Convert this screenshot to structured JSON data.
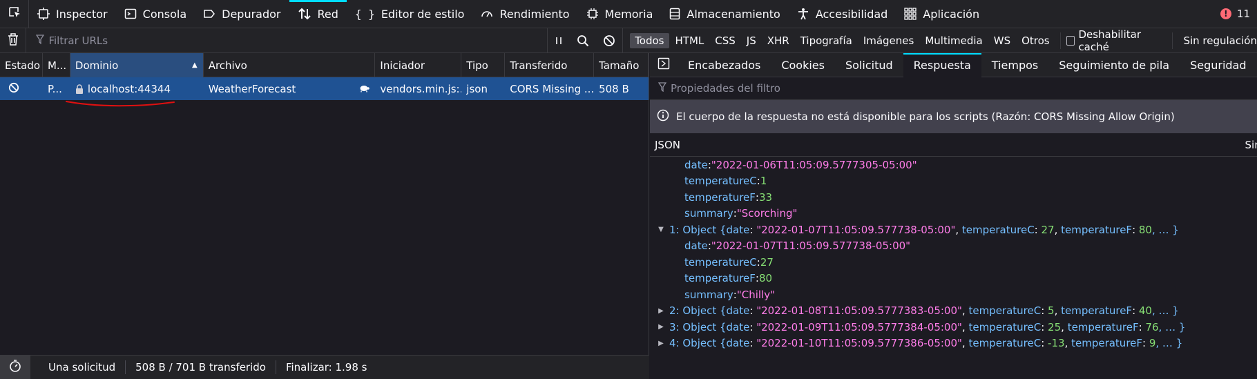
{
  "toolbox": {
    "tabs": [
      {
        "label": "Inspector",
        "icon": "inspector-icon"
      },
      {
        "label": "Consola",
        "icon": "console-icon"
      },
      {
        "label": "Depurador",
        "icon": "debugger-icon"
      },
      {
        "label": "Red",
        "icon": "network-arrows-icon",
        "selected": true
      },
      {
        "label": "Editor de estilo",
        "icon": "braces-icon"
      },
      {
        "label": "Rendimiento",
        "icon": "gauge-icon"
      },
      {
        "label": "Memoria",
        "icon": "chip-icon"
      },
      {
        "label": "Almacenamiento",
        "icon": "storage-icon"
      },
      {
        "label": "Accesibilidad",
        "icon": "accessibility-icon"
      },
      {
        "label": "Aplicación",
        "icon": "grid-icon"
      }
    ],
    "error_count": "11",
    "accent_color": "#00ddff",
    "error_color": "#ff6a75"
  },
  "toolbar": {
    "filter_placeholder": "Filtrar URLs",
    "types": [
      "Todos",
      "HTML",
      "CSS",
      "JS",
      "XHR",
      "Tipografía",
      "Imágenes",
      "Multimedia",
      "WS",
      "Otros"
    ],
    "active_type": "Todos",
    "disable_cache_label": "Deshabilitar caché",
    "throttle_label": "Sin regulación"
  },
  "table": {
    "columns": [
      "Estado",
      "M...",
      "Dominio",
      "Archivo",
      "Iniciador",
      "Tipo",
      "Transferido",
      "Tamaño"
    ],
    "sorted_column": "Dominio",
    "rows": [
      {
        "status_icon": "blocked-icon",
        "method": "P...",
        "domain": "localhost:44344",
        "file": "WeatherForecast",
        "initiator": "vendors.min.js:...",
        "type": "json",
        "transferred": "CORS Missing ...",
        "size": "508 B"
      }
    ],
    "selected_row_color": "#1f5293"
  },
  "statusbar": {
    "requests": "Una solicitud",
    "transferred": "508 B / 701 B transferido",
    "finish": "Finalizar: 1.98 s"
  },
  "details": {
    "tabs": [
      "Encabezados",
      "Cookies",
      "Solicitud",
      "Respuesta",
      "Tiempos",
      "Seguimiento de pila",
      "Seguridad"
    ],
    "selected_tab": "Respuesta",
    "filter_placeholder": "Propiedades del filtro",
    "notice": "El cuerpo de la respuesta no está disponible para los scripts (Razón: CORS Missing Allow Origin)",
    "json_label": "JSON",
    "json_right_label": "Sin p",
    "lines": {
      "l1": {
        "key": "date",
        "val": "\"2022-01-06T11:05:09.5777305-05:00\""
      },
      "l2": {
        "key": "temperatureC",
        "val": "1"
      },
      "l3": {
        "key": "temperatureF",
        "val": "33"
      },
      "l4": {
        "key": "summary",
        "val": "\"Scorching\""
      },
      "o1": {
        "head": "1: Object { ",
        "k1": "date",
        "v1": "\"2022-01-07T11:05:09.577738-05:00\"",
        "k2": "temperatureC",
        "v2": "27",
        "k3": "temperatureF",
        "v3": "80",
        "tail": ", … }"
      },
      "l5": {
        "key": "date",
        "val": "\"2022-01-07T11:05:09.577738-05:00\""
      },
      "l6": {
        "key": "temperatureC",
        "val": "27"
      },
      "l7": {
        "key": "temperatureF",
        "val": "80"
      },
      "l8": {
        "key": "summary",
        "val": "\"Chilly\""
      },
      "o2": {
        "head": "2: Object { ",
        "k1": "date",
        "v1": "\"2022-01-08T11:05:09.5777383-05:00\"",
        "k2": "temperatureC",
        "v2": "5",
        "k3": "temperatureF",
        "v3": "40",
        "tail": ", … }"
      },
      "o3": {
        "head": "3: Object { ",
        "k1": "date",
        "v1": "\"2022-01-09T11:05:09.5777384-05:00\"",
        "k2": "temperatureC",
        "v2": "25",
        "k3": "temperatureF",
        "v3": "76",
        "tail": ", … }"
      },
      "o4": {
        "head": "4: Object { ",
        "k1": "date",
        "v1": "\"2022-01-10T11:05:09.5777386-05:00\"",
        "k2": "temperatureC",
        "v2": "-13",
        "k3": "temperatureF",
        "v3": "9",
        "tail": ", … }"
      }
    }
  }
}
